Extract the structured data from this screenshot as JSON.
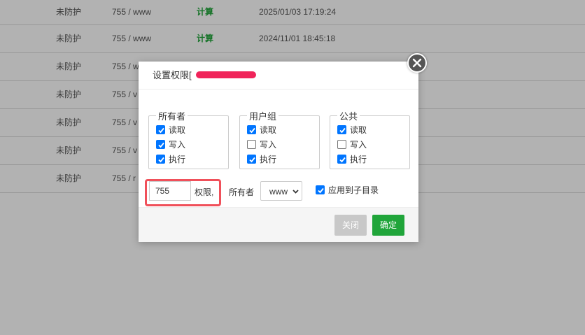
{
  "background_table": {
    "rows": [
      {
        "protection": "未防护",
        "permission": "755 / www",
        "action": "计算",
        "time": "2025/01/03 17:19:24"
      },
      {
        "protection": "未防护",
        "permission": "755 / www",
        "action": "计算",
        "time": "2024/11/01 18:45:18"
      },
      {
        "protection": "未防护",
        "permission": "755 / w",
        "action": "",
        "time": ""
      },
      {
        "protection": "未防护",
        "permission": "755 / v",
        "action": "",
        "time": ""
      },
      {
        "protection": "未防护",
        "permission": "755 / v",
        "action": "",
        "time": ""
      },
      {
        "protection": "未防护",
        "permission": "755 / v",
        "action": "",
        "time": ""
      },
      {
        "protection": "未防护",
        "permission": "755 / r",
        "action": "",
        "time": ""
      }
    ]
  },
  "dialog": {
    "title": "设置权限[",
    "groups": [
      {
        "legend": "所有者",
        "items": [
          {
            "label": "读取",
            "checked": true
          },
          {
            "label": "写入",
            "checked": true
          },
          {
            "label": "执行",
            "checked": true
          }
        ]
      },
      {
        "legend": "用户组",
        "items": [
          {
            "label": "读取",
            "checked": true
          },
          {
            "label": "写入",
            "checked": false
          },
          {
            "label": "执行",
            "checked": true
          }
        ]
      },
      {
        "legend": "公共",
        "items": [
          {
            "label": "读取",
            "checked": true
          },
          {
            "label": "写入",
            "checked": false
          },
          {
            "label": "执行",
            "checked": true
          }
        ]
      }
    ],
    "permission_value": "755",
    "permission_suffix": "权限,",
    "owner_label": "所有者",
    "owner_selected": "www",
    "apply_subdir_label": "应用到子目录",
    "apply_subdir_checked": true,
    "close_label": "关闭",
    "confirm_label": "确定"
  },
  "colors": {
    "accent_green": "#20a53a",
    "checkbox_blue": "#0075ff",
    "highlight_red": "#f0505a"
  }
}
